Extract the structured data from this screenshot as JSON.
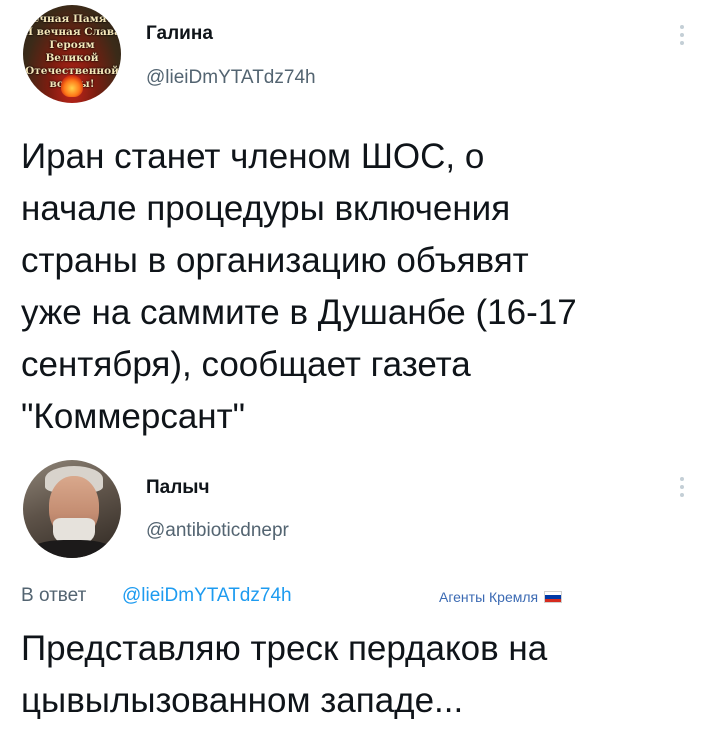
{
  "tweets": [
    {
      "author": {
        "name": "Галина",
        "handle": "@lieiDmYTATdz74h"
      },
      "avatar": {
        "banner_lines": [
          "Вечная Память",
          "И вечная Слава",
          "Героям Великой",
          "Отечественной",
          "войны!"
        ]
      },
      "text": "Иран станет членом ШОС, о\nначале процедуры включения\nстраны в организацию объявят\nуже на саммите в Душанбе (16-17\nсентября), сообщает газета\n\"Коммерсант\""
    },
    {
      "author": {
        "name": "Палыч",
        "handle": "@antibioticdnepr"
      },
      "reply": {
        "prefix": "В ответ",
        "handle": "@lieiDmYTATdz74h"
      },
      "badge": {
        "label": "Агенты Кремля",
        "flag_colors": [
          "#ffffff",
          "#0039a6",
          "#d52b1e"
        ]
      },
      "text": "Представляю треск пердаков на\nцывылызованном западе..."
    }
  ],
  "colors": {
    "text": "#0f1419",
    "secondary": "#536471",
    "link": "#1d9bf0",
    "badge": "#3b6ab3"
  }
}
